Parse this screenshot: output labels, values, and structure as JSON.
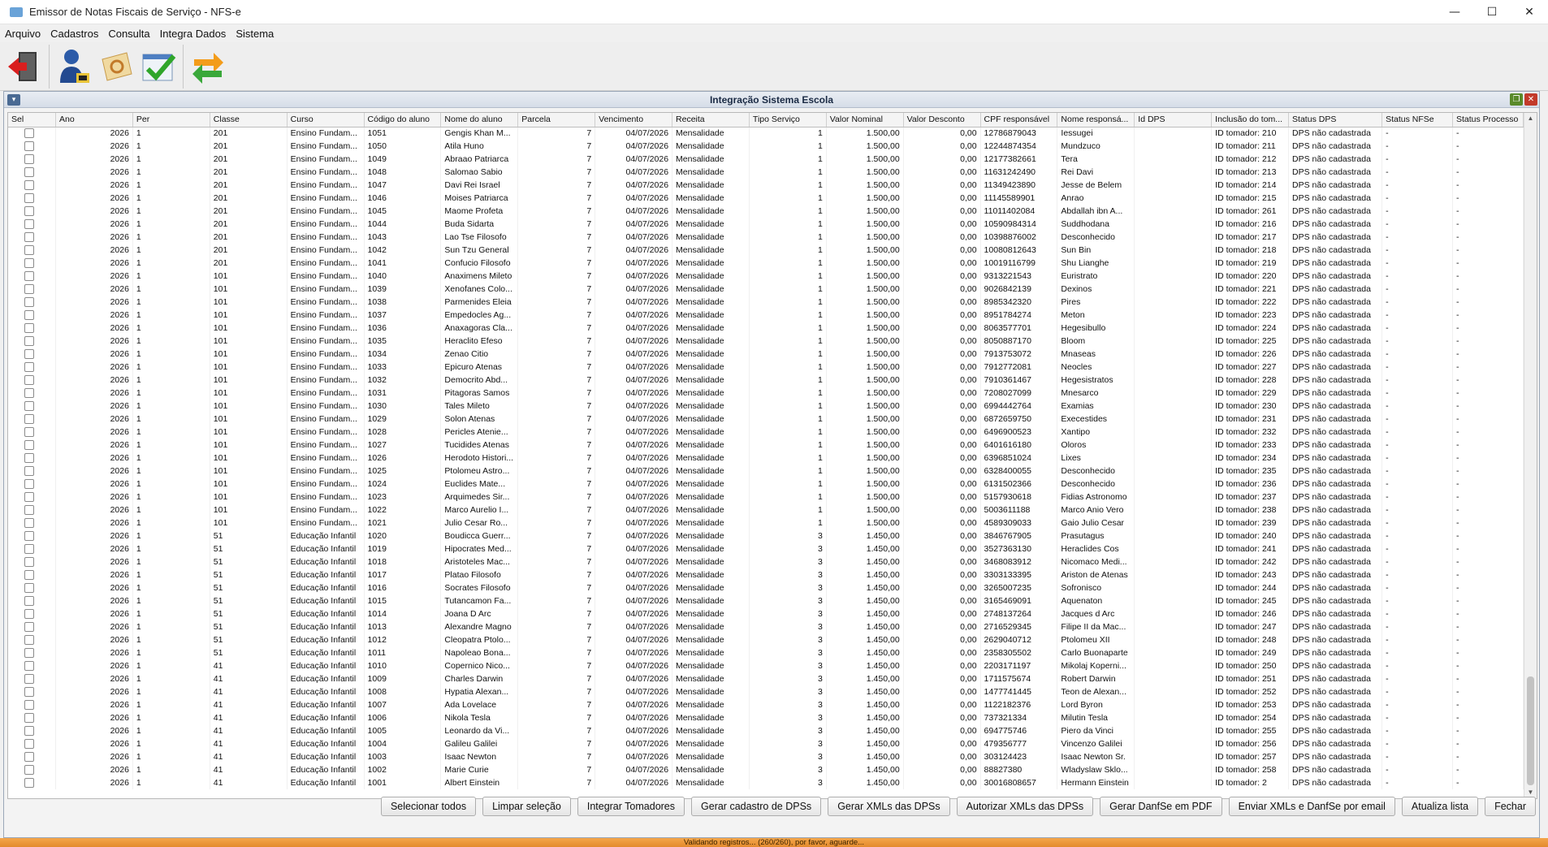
{
  "app": {
    "title": "Emissor de Notas Fiscais de Serviço - NFS-e",
    "window_controls": {
      "minimize": "—",
      "maximize": "☐",
      "close": "✕"
    }
  },
  "menu": [
    "Arquivo",
    "Cadastros",
    "Consulta",
    "Integra Dados",
    "Sistema"
  ],
  "toolbar": [
    {
      "name": "exit-icon"
    },
    {
      "name": "user-icon"
    },
    {
      "name": "tools-icon"
    },
    {
      "name": "checklist-icon"
    },
    {
      "name": "sync-icon"
    }
  ],
  "frame": {
    "title": "Integração Sistema Escola",
    "menu_icon": "▾",
    "restore_icon": "❐",
    "close_icon": "✕"
  },
  "columns": [
    "Sel",
    "Ano",
    "Per",
    "Classe",
    "Curso",
    "Código do aluno",
    "Nome do aluno",
    "Parcela",
    "Vencimento",
    "Receita",
    "Tipo Serviço",
    "Valor Nominal",
    "Valor Desconto",
    "CPF responsável",
    "Nome responsá...",
    "Id DPS",
    "Inclusão do tom...",
    "Status DPS",
    "Status NFSe",
    "Status Processo"
  ],
  "row_defaults": {
    "ano": "2026",
    "per": "1",
    "parcela": "7",
    "vencimento": "04/07/2026",
    "receita": "Mensalidade",
    "desconto": "0,00",
    "id_dps": "",
    "status_dps": "DPS não cadastrada",
    "status_nfse": "-",
    "status_proc": "-"
  },
  "rows": [
    [
      "201",
      "Ensino Fundam...",
      "1051",
      "Gengis Khan M...",
      "1",
      "1.500,00",
      "12786879043",
      "Iessugei",
      "ID tomador: 210"
    ],
    [
      "201",
      "Ensino Fundam...",
      "1050",
      "Atila Huno",
      "1",
      "1.500,00",
      "12244874354",
      "Mundzuco",
      "ID tomador: 211"
    ],
    [
      "201",
      "Ensino Fundam...",
      "1049",
      "Abraao Patriarca",
      "1",
      "1.500,00",
      "12177382661",
      "Tera",
      "ID tomador: 212"
    ],
    [
      "201",
      "Ensino Fundam...",
      "1048",
      "Salomao Sabio",
      "1",
      "1.500,00",
      "11631242490",
      "Rei Davi",
      "ID tomador: 213"
    ],
    [
      "201",
      "Ensino Fundam...",
      "1047",
      "Davi Rei Israel",
      "1",
      "1.500,00",
      "11349423890",
      "Jesse de Belem",
      "ID tomador: 214"
    ],
    [
      "201",
      "Ensino Fundam...",
      "1046",
      "Moises Patriarca",
      "1",
      "1.500,00",
      "11145589901",
      "Anrao",
      "ID tomador: 215"
    ],
    [
      "201",
      "Ensino Fundam...",
      "1045",
      "Maome Profeta",
      "1",
      "1.500,00",
      "11011402084",
      "Abdallah ibn A...",
      "ID tomador: 261"
    ],
    [
      "201",
      "Ensino Fundam...",
      "1044",
      "Buda Sidarta",
      "1",
      "1.500,00",
      "10590984314",
      "Suddhodana",
      "ID tomador: 216"
    ],
    [
      "201",
      "Ensino Fundam...",
      "1043",
      "Lao Tse Filosofo",
      "1",
      "1.500,00",
      "10398876002",
      "Desconhecido",
      "ID tomador: 217"
    ],
    [
      "201",
      "Ensino Fundam...",
      "1042",
      "Sun Tzu General",
      "1",
      "1.500,00",
      "10080812643",
      "Sun Bin",
      "ID tomador: 218"
    ],
    [
      "201",
      "Ensino Fundam...",
      "1041",
      "Confucio Filosofo",
      "1",
      "1.500,00",
      "10019116799",
      "Shu Lianghe",
      "ID tomador: 219"
    ],
    [
      "101",
      "Ensino Fundam...",
      "1040",
      "Anaximens Mileto",
      "1",
      "1.500,00",
      "9313221543",
      "Euristrato",
      "ID tomador: 220"
    ],
    [
      "101",
      "Ensino Fundam...",
      "1039",
      "Xenofanes Colo...",
      "1",
      "1.500,00",
      "9026842139",
      "Dexinos",
      "ID tomador: 221"
    ],
    [
      "101",
      "Ensino Fundam...",
      "1038",
      "Parmenides Eleia",
      "1",
      "1.500,00",
      "8985342320",
      "Pires",
      "ID tomador: 222"
    ],
    [
      "101",
      "Ensino Fundam...",
      "1037",
      "Empedocles Ag...",
      "1",
      "1.500,00",
      "8951784274",
      "Meton",
      "ID tomador: 223"
    ],
    [
      "101",
      "Ensino Fundam...",
      "1036",
      "Anaxagoras Cla...",
      "1",
      "1.500,00",
      "8063577701",
      "Hegesibullo",
      "ID tomador: 224"
    ],
    [
      "101",
      "Ensino Fundam...",
      "1035",
      "Heraclito Efeso",
      "1",
      "1.500,00",
      "8050887170",
      "Bloom",
      "ID tomador: 225"
    ],
    [
      "101",
      "Ensino Fundam...",
      "1034",
      "Zenao Citio",
      "1",
      "1.500,00",
      "7913753072",
      "Mnaseas",
      "ID tomador: 226"
    ],
    [
      "101",
      "Ensino Fundam...",
      "1033",
      "Epicuro Atenas",
      "1",
      "1.500,00",
      "7912772081",
      "Neocles",
      "ID tomador: 227"
    ],
    [
      "101",
      "Ensino Fundam...",
      "1032",
      "Democrito Abd...",
      "1",
      "1.500,00",
      "7910361467",
      "Hegesistratos",
      "ID tomador: 228"
    ],
    [
      "101",
      "Ensino Fundam...",
      "1031",
      "Pitagoras Samos",
      "1",
      "1.500,00",
      "7208027099",
      "Mnesarco",
      "ID tomador: 229"
    ],
    [
      "101",
      "Ensino Fundam...",
      "1030",
      "Tales Mileto",
      "1",
      "1.500,00",
      "6994442764",
      "Examias",
      "ID tomador: 230"
    ],
    [
      "101",
      "Ensino Fundam...",
      "1029",
      "Solon Atenas",
      "1",
      "1.500,00",
      "6872659750",
      "Execestides",
      "ID tomador: 231"
    ],
    [
      "101",
      "Ensino Fundam...",
      "1028",
      "Pericles Atenie...",
      "1",
      "1.500,00",
      "6496900523",
      "Xantipo",
      "ID tomador: 232"
    ],
    [
      "101",
      "Ensino Fundam...",
      "1027",
      "Tucidides Atenas",
      "1",
      "1.500,00",
      "6401616180",
      "Oloros",
      "ID tomador: 233"
    ],
    [
      "101",
      "Ensino Fundam...",
      "1026",
      "Herodoto Histori...",
      "1",
      "1.500,00",
      "6396851024",
      "Lixes",
      "ID tomador: 234"
    ],
    [
      "101",
      "Ensino Fundam...",
      "1025",
      "Ptolomeu Astro...",
      "1",
      "1.500,00",
      "6328400055",
      "Desconhecido",
      "ID tomador: 235"
    ],
    [
      "101",
      "Ensino Fundam...",
      "1024",
      "Euclides Mate...",
      "1",
      "1.500,00",
      "6131502366",
      "Desconhecido",
      "ID tomador: 236"
    ],
    [
      "101",
      "Ensino Fundam...",
      "1023",
      "Arquimedes Sir...",
      "1",
      "1.500,00",
      "5157930618",
      "Fidias Astronomo",
      "ID tomador: 237"
    ],
    [
      "101",
      "Ensino Fundam...",
      "1022",
      "Marco Aurelio I...",
      "1",
      "1.500,00",
      "5003611188",
      "Marco Anio Vero",
      "ID tomador: 238"
    ],
    [
      "101",
      "Ensino Fundam...",
      "1021",
      "Julio Cesar Ro...",
      "1",
      "1.500,00",
      "4589309033",
      "Gaio Julio Cesar",
      "ID tomador: 239"
    ],
    [
      "51",
      "Educação Infantil",
      "1020",
      "Boudicca Guerr...",
      "3",
      "1.450,00",
      "3846767905",
      "Prasutagus",
      "ID tomador: 240"
    ],
    [
      "51",
      "Educação Infantil",
      "1019",
      "Hipocrates Med...",
      "3",
      "1.450,00",
      "3527363130",
      "Heraclides Cos",
      "ID tomador: 241"
    ],
    [
      "51",
      "Educação Infantil",
      "1018",
      "Aristoteles Mac...",
      "3",
      "1.450,00",
      "3468083912",
      "Nicomaco Medi...",
      "ID tomador: 242"
    ],
    [
      "51",
      "Educação Infantil",
      "1017",
      "Platao Filosofo",
      "3",
      "1.450,00",
      "3303133395",
      "Ariston de Atenas",
      "ID tomador: 243"
    ],
    [
      "51",
      "Educação Infantil",
      "1016",
      "Socrates Filosofo",
      "3",
      "1.450,00",
      "3265007235",
      "Sofronisco",
      "ID tomador: 244"
    ],
    [
      "51",
      "Educação Infantil",
      "1015",
      "Tutancamon Fa...",
      "3",
      "1.450,00",
      "3165469091",
      "Aquenaton",
      "ID tomador: 245"
    ],
    [
      "51",
      "Educação Infantil",
      "1014",
      "Joana D Arc",
      "3",
      "1.450,00",
      "2748137264",
      "Jacques d Arc",
      "ID tomador: 246"
    ],
    [
      "51",
      "Educação Infantil",
      "1013",
      "Alexandre Magno",
      "3",
      "1.450,00",
      "2716529345",
      "Filipe II da Mac...",
      "ID tomador: 247"
    ],
    [
      "51",
      "Educação Infantil",
      "1012",
      "Cleopatra Ptolo...",
      "3",
      "1.450,00",
      "2629040712",
      "Ptolomeu XII",
      "ID tomador: 248"
    ],
    [
      "51",
      "Educação Infantil",
      "1011",
      "Napoleao Bona...",
      "3",
      "1.450,00",
      "2358305502",
      "Carlo Buonaparte",
      "ID tomador: 249"
    ],
    [
      "41",
      "Educação Infantil",
      "1010",
      "Copernico Nico...",
      "3",
      "1.450,00",
      "2203171197",
      "Mikolaj Koperni...",
      "ID tomador: 250"
    ],
    [
      "41",
      "Educação Infantil",
      "1009",
      "Charles Darwin",
      "3",
      "1.450,00",
      "1711575674",
      "Robert Darwin",
      "ID tomador: 251"
    ],
    [
      "41",
      "Educação Infantil",
      "1008",
      "Hypatia Alexan...",
      "3",
      "1.450,00",
      "1477741445",
      "Teon de Alexan...",
      "ID tomador: 252"
    ],
    [
      "41",
      "Educação Infantil",
      "1007",
      "Ada Lovelace",
      "3",
      "1.450,00",
      "1122182376",
      "Lord Byron",
      "ID tomador: 253"
    ],
    [
      "41",
      "Educação Infantil",
      "1006",
      "Nikola Tesla",
      "3",
      "1.450,00",
      "737321334",
      "Milutin Tesla",
      "ID tomador: 254"
    ],
    [
      "41",
      "Educação Infantil",
      "1005",
      "Leonardo da Vi...",
      "3",
      "1.450,00",
      "694775746",
      "Piero da Vinci",
      "ID tomador: 255"
    ],
    [
      "41",
      "Educação Infantil",
      "1004",
      "Galileu Galilei",
      "3",
      "1.450,00",
      "479356777",
      "Vincenzo Galilei",
      "ID tomador: 256"
    ],
    [
      "41",
      "Educação Infantil",
      "1003",
      "Isaac Newton",
      "3",
      "1.450,00",
      "303124423",
      "Isaac Newton Sr.",
      "ID tomador: 257"
    ],
    [
      "41",
      "Educação Infantil",
      "1002",
      "Marie Curie",
      "3",
      "1.450,00",
      "88827380",
      "Wladyslaw Sklo...",
      "ID tomador: 258"
    ],
    [
      "41",
      "Educação Infantil",
      "1001",
      "Albert Einstein",
      "3",
      "1.450,00",
      "30016808657",
      "Hermann Einstein",
      "ID tomador: 2"
    ]
  ],
  "buttons": [
    "Selecionar todos",
    "Limpar seleção",
    "Integrar Tomadores",
    "Gerar cadastro de DPSs",
    "Gerar XMLs das DPSs",
    "Autorizar XMLs das DPSs",
    "Gerar DanfSe em PDF",
    "Enviar XMLs e DanfSe por email",
    "Atualiza lista",
    "Fechar"
  ],
  "status": "Validando registros... (260/260), por favor, aguarde...",
  "colors": {
    "status_bar": "#e8922f",
    "frame_border": "#9aa7b8",
    "restore_btn": "#5a8a2a",
    "close_btn": "#c23a2a"
  }
}
